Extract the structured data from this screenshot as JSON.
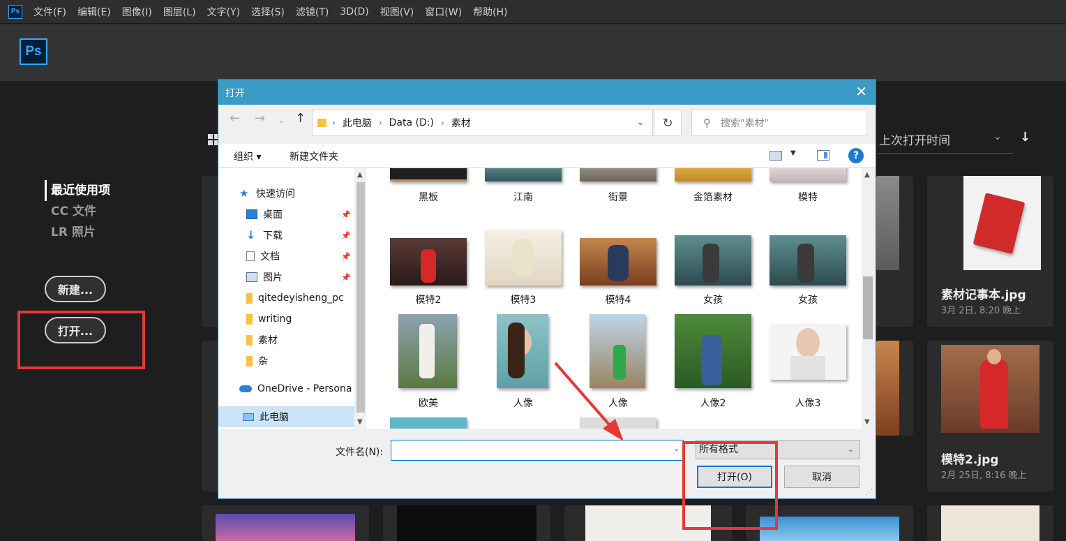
{
  "menubar": {
    "logo": "Ps",
    "items": [
      "文件(F)",
      "编辑(E)",
      "图像(I)",
      "图层(L)",
      "文字(Y)",
      "选择(S)",
      "滤镜(T)",
      "3D(D)",
      "视图(V)",
      "窗口(W)",
      "帮助(H)"
    ]
  },
  "header": {
    "logo": "Ps"
  },
  "left_nav": {
    "items": [
      {
        "label": "最近使用项",
        "active": true
      },
      {
        "label": "CC 文件",
        "active": false
      },
      {
        "label": "LR 照片",
        "active": false
      }
    ],
    "new_button": "新建...",
    "open_button": "打开..."
  },
  "sort": {
    "label": "上次打开时间"
  },
  "cards": [
    {
      "name": "素材记事本.jpg",
      "date": "3月 2日, 8:20 晚上"
    },
    {
      "name": "模特2.jpg",
      "date": "2月 25日, 8:16 晚上"
    }
  ],
  "dialog": {
    "title": "打开",
    "close_glyph": "✕",
    "address": {
      "segments": [
        "此电脑",
        "Data (D:)",
        "素材"
      ]
    },
    "search_placeholder": "搜索\"素材\"",
    "toolbar": {
      "organize": "组织 ▾",
      "new_folder": "新建文件夹",
      "help": "?"
    },
    "nav_items": [
      {
        "label": "快速访问",
        "icon": "star-icon",
        "pinned": false
      },
      {
        "label": "桌面",
        "icon": "desktop-icon",
        "pinned": true
      },
      {
        "label": "下载",
        "icon": "download-icon",
        "pinned": true
      },
      {
        "label": "文档",
        "icon": "document-icon",
        "pinned": true
      },
      {
        "label": "图片",
        "icon": "pictures-icon",
        "pinned": true
      },
      {
        "label": "qitedeyisheng_pc",
        "icon": "folder-icon",
        "pinned": false
      },
      {
        "label": "writing",
        "icon": "folder-icon",
        "pinned": false
      },
      {
        "label": "素材",
        "icon": "folder-icon",
        "pinned": false
      },
      {
        "label": "杂",
        "icon": "folder-icon",
        "pinned": false
      },
      {
        "label": "OneDrive - Persona",
        "icon": "cloud-icon",
        "pinned": false
      },
      {
        "label": "此电脑",
        "icon": "computer-icon",
        "pinned": false
      }
    ],
    "files_row1": [
      "黑板",
      "江南",
      "街景",
      "金箔素材",
      "模特"
    ],
    "files_row2": [
      "模特2",
      "模特3",
      "模特4",
      "女孩",
      "女孩"
    ],
    "files_row3": [
      "欧美",
      "人像",
      "人像",
      "人像2",
      "人像3"
    ],
    "filename_label": "文件名(N):",
    "filename_value": "",
    "filetype": "所有格式",
    "open_button": "打开(O)",
    "cancel_button": "取消"
  },
  "colors": {
    "accent": "#31a8ff",
    "highlight": "#e53935",
    "dialog_title": "#3a9bc7"
  }
}
